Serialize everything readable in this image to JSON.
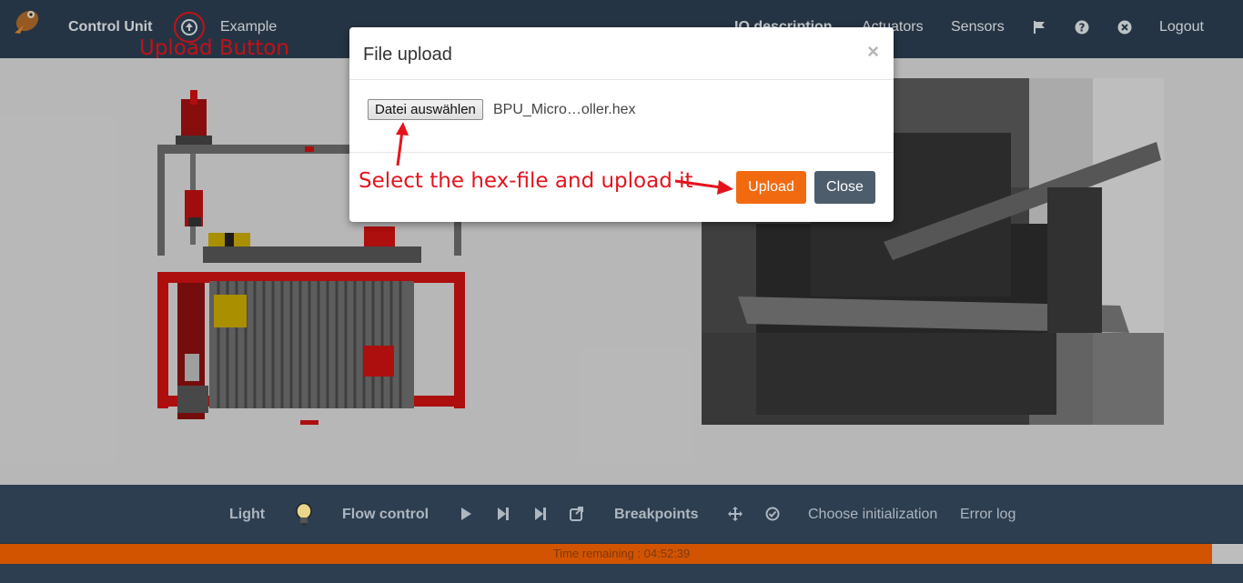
{
  "navbar": {
    "brand": "Control Unit",
    "example": "Example",
    "io_description": "IO description",
    "actuators": "Actuators",
    "sensors": "Sensors",
    "logout": "Logout",
    "icons": [
      "upload-icon",
      "flag-icon",
      "help-icon",
      "close-circle-icon"
    ]
  },
  "annotations": {
    "upload_button": "Upload Button",
    "select_hex": "Select the hex-file and upload it"
  },
  "modal": {
    "title": "File upload",
    "close_symbol": "×",
    "file_button": "Datei auswählen",
    "file_name": "BPU_Micro…oller.hex",
    "upload": "Upload",
    "close": "Close"
  },
  "toolbar": {
    "light": "Light",
    "flow_control": "Flow control",
    "breakpoints": "Breakpoints",
    "choose_init": "Choose initialization",
    "error_log": "Error log"
  },
  "progress": {
    "text": "Time remaining : 04:52:39",
    "fraction": 0.975
  },
  "colors": {
    "nav_bg": "#2c3e50",
    "accent": "#f26a10",
    "annotation": "#e4141d"
  }
}
